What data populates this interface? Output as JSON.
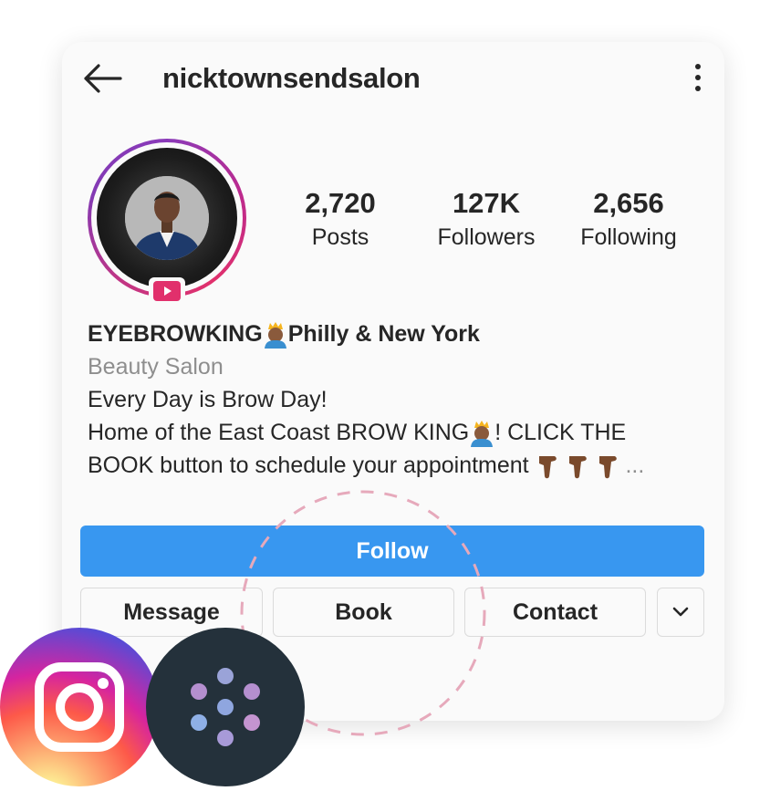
{
  "header": {
    "username": "nicktownsendsalon",
    "back_icon": "arrow-left-icon",
    "more_icon": "kebab-menu-icon"
  },
  "profile": {
    "stats": [
      {
        "value": "2,720",
        "label": "Posts"
      },
      {
        "value": "127K",
        "label": "Followers"
      },
      {
        "value": "2,656",
        "label": "Following"
      }
    ]
  },
  "bio": {
    "name_part1": "EYEBROWKING",
    "name_part2": "Philly & New York",
    "category": "Beauty Salon",
    "line1": "Every Day is Brow Day!",
    "line2_part1": "Home of the East Coast BROW KING",
    "line2_part2": "!  CLICK THE",
    "line3": "BOOK button to schedule your appointment",
    "more": "..."
  },
  "actions": {
    "follow": "Follow",
    "message": "Message",
    "book": "Book",
    "contact": "Contact"
  },
  "colors": {
    "follow_blue": "#3897f0",
    "ring_purple": "#8a3ab9",
    "badge_pink": "#e1306c",
    "dots_bg": "#24313b"
  }
}
